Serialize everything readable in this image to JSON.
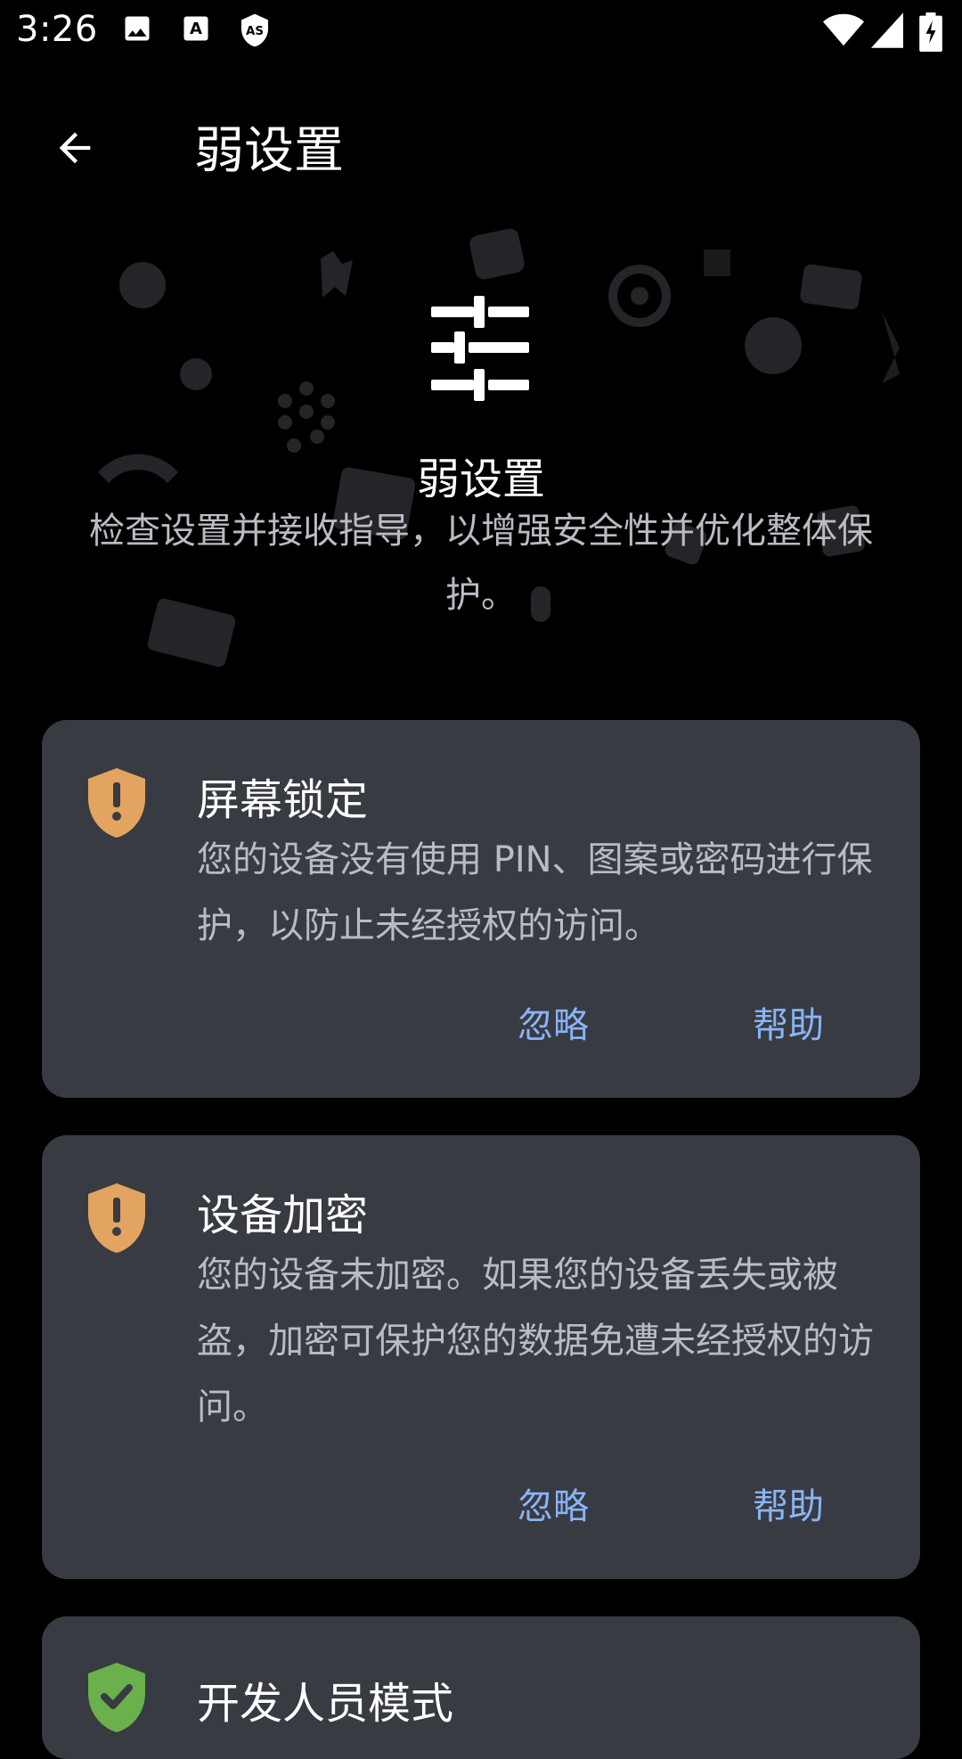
{
  "status_bar": {
    "time": "3:26",
    "icons": [
      "image-icon",
      "text-a-icon",
      "as-shield-icon",
      "wifi-icon",
      "signal-icon",
      "battery-charging-icon"
    ]
  },
  "app_bar": {
    "title": "弱设置",
    "back_icon": "arrow-back-icon"
  },
  "hero": {
    "icon": "tune-sliders-icon",
    "title": "弱设置",
    "description": "检查设置并接收指导，以增强安全性并优化整体保护。"
  },
  "cards": [
    {
      "title": "屏幕锁定",
      "description": "您的设备没有使用 PIN、图案或密码进行保护，以防止未经授权的访问。",
      "status": "warning",
      "icon_color": "#e2a460",
      "ignore_label": "忽略",
      "help_label": "帮助"
    },
    {
      "title": "设备加密",
      "description": "您的设备未加密。如果您的设备丢失或被盗，加密可保护您的数据免遭未经授权的访问。",
      "status": "warning",
      "icon_color": "#e2a460",
      "ignore_label": "忽略",
      "help_label": "帮助"
    },
    {
      "title": "开发人员模式",
      "status": "ok",
      "icon_color": "#6ab04c"
    }
  ],
  "colors": {
    "background": "#000000",
    "card": "#383b41",
    "accent_link": "#8ab4f8",
    "warning": "#e2a460",
    "ok": "#6ab04c"
  }
}
